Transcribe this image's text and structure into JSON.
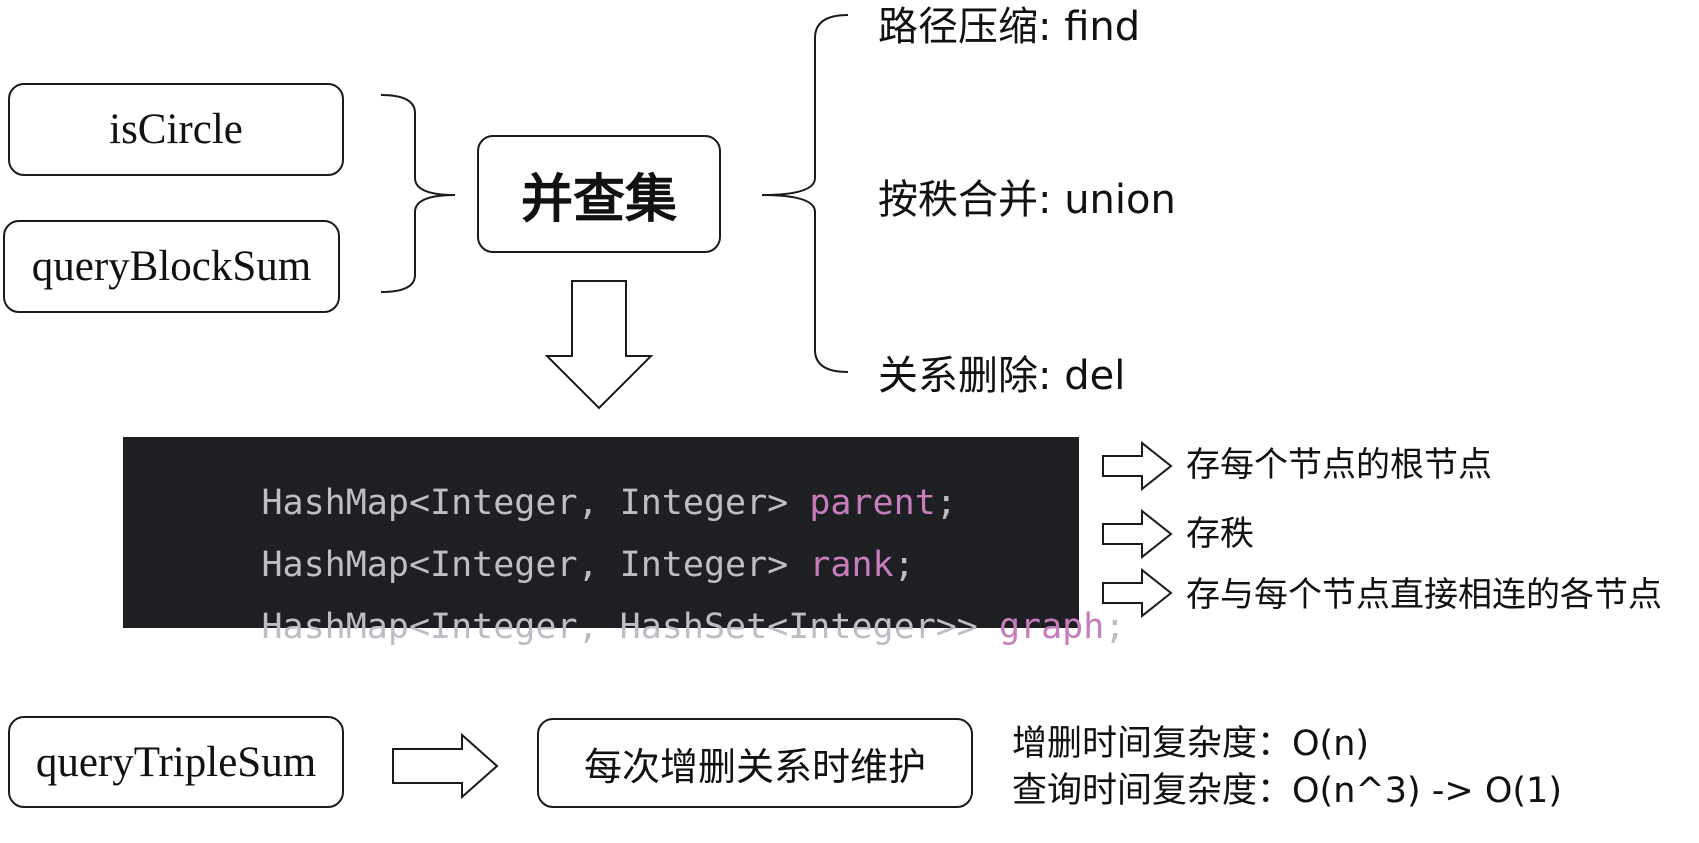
{
  "left_methods": [
    "isCircle",
    "queryBlockSum"
  ],
  "center": {
    "title": "并查集"
  },
  "operations": [
    {
      "label": "路径压缩: find"
    },
    {
      "label": "按秩合并: union"
    },
    {
      "label": "关系删除: del"
    }
  ],
  "code": {
    "lines": [
      {
        "type": "HashMap<Integer, Integer> ",
        "name": "parent",
        "end": ";"
      },
      {
        "type": "HashMap<Integer, Integer> ",
        "name": "rank",
        "end": ";"
      },
      {
        "type": "HashMap<Integer, HashSet<Integer>> ",
        "name": "graph",
        "end": ";"
      }
    ],
    "notes": [
      "存每个节点的根节点",
      "存秩",
      "存与每个节点直接相连的各节点"
    ]
  },
  "bottom": {
    "method": "queryTripleSum",
    "action": "每次增删关系时维护",
    "complexity": [
      "增删时间复杂度：O(n)",
      "查询时间复杂度：O(n^3) -> O(1)"
    ]
  },
  "colors": {
    "code_bg": "#1e1f22",
    "code_text": "#bcbec4",
    "code_var": "#c77dbb",
    "stroke": "#1a1a1a"
  }
}
